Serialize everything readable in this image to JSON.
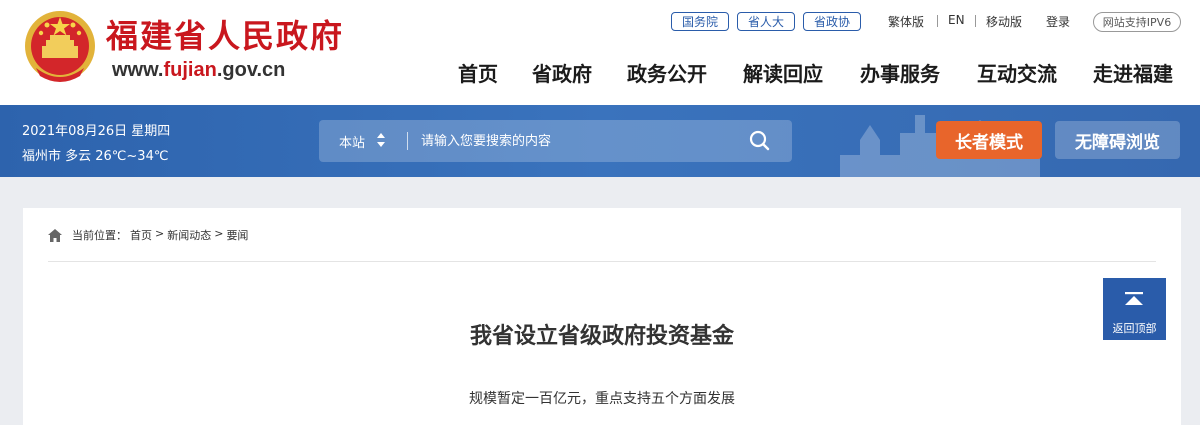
{
  "header": {
    "site_title": "福建省人民政府",
    "url_prefix": "www.",
    "url_highlight": "fujian",
    "url_suffix": ".gov.cn",
    "top_pills": [
      "国务院",
      "省人大",
      "省政协"
    ],
    "top_links": [
      "繁体版",
      "EN",
      "移动版",
      "登录"
    ],
    "ipv6_badge": "网站支持IPV6",
    "nav": [
      "首页",
      "省政府",
      "政务公开",
      "解读回应",
      "办事服务",
      "互动交流",
      "走进福建"
    ]
  },
  "band": {
    "date": "2021年08月26日 星期四",
    "weather": "福州市 多云 26℃~34℃",
    "search_scope": "本站",
    "search_placeholder": "请输入您要搜索的内容",
    "elder_mode": "长者模式",
    "accessibility": "无障碍浏览"
  },
  "breadcrumb": {
    "label": "当前位置：",
    "items": [
      "首页",
      "新闻动态",
      "要闻"
    ],
    "separator": ">"
  },
  "article": {
    "title": "我省设立省级政府投资基金",
    "subtitle": "规模暂定一百亿元，重点支持五个方面发展"
  },
  "back_to_top": "返回顶部",
  "icons": {
    "emblem": "national-emblem-icon",
    "search": "search-icon",
    "scope_toggle": "sort-arrows-icon",
    "home": "home-icon",
    "back_top": "arrow-up-icon"
  },
  "colors": {
    "brand_red": "#c9171e",
    "brand_blue": "#2a5caa",
    "elder_orange": "#e8652b"
  }
}
